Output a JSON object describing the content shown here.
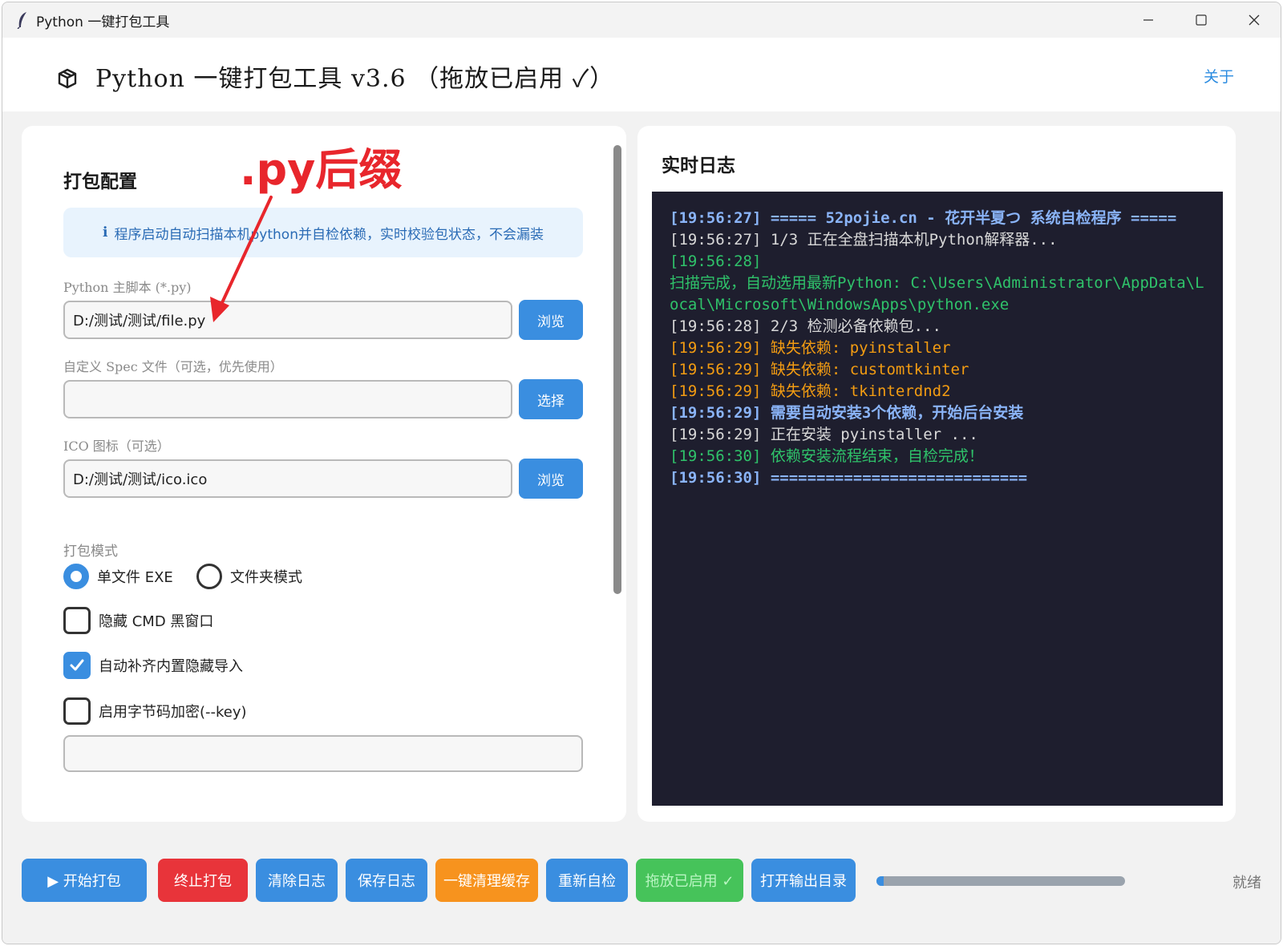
{
  "window": {
    "title": "Python 一键打包工具"
  },
  "header": {
    "title": "Python 一键打包工具 v3.6 （拖放已启用 ✓）",
    "about": "关于"
  },
  "config": {
    "section_title": "打包配置",
    "annotation": ".py后缀",
    "info": "程序启动自动扫描本机python并自检依赖，实时校验包状态，不会漏装",
    "info_icon": "ℹ",
    "script_label": "Python 主脚本 (*.py)",
    "script_value": "D:/测试/测试/file.py",
    "browse1": "浏览",
    "spec_label": "自定义 Spec 文件（可选，优先使用）",
    "spec_value": "",
    "choose": "选择",
    "ico_label": "ICO 图标（可选）",
    "ico_value": "D:/测试/测试/ico.ico",
    "browse2": "浏览",
    "mode_label": "打包模式",
    "mode_onefile": "单文件 EXE",
    "mode_folder": "文件夹模式",
    "hide_cmd": "隐藏 CMD 黑窗口",
    "auto_imports": "自动补齐内置隐藏导入",
    "encrypt": "启用字节码加密(--key)",
    "key_value": ""
  },
  "log": {
    "title": "实时日志",
    "lines": [
      {
        "text": "[19:56:27] ===== 52pojie.cn - 花开半夏つ 系统自检程序 =====",
        "kind": "blue"
      },
      {
        "text": "[19:56:27] 1/3 正在全盘扫描本机Python解释器...",
        "kind": "white"
      },
      {
        "text": "[19:56:28]",
        "kind": "green"
      },
      {
        "text": "扫描完成，自动选用最新Python: C:\\Users\\Administrator\\AppData\\Local\\Microsoft\\WindowsApps\\python.exe",
        "kind": "green"
      },
      {
        "text": "[19:56:28] 2/3 检测必备依赖包...",
        "kind": "white"
      },
      {
        "text": "[19:56:29] 缺失依赖: pyinstaller",
        "kind": "orange"
      },
      {
        "text": "[19:56:29] 缺失依赖: customtkinter",
        "kind": "orange"
      },
      {
        "text": "[19:56:29] 缺失依赖: tkinterdnd2",
        "kind": "orange"
      },
      {
        "text": "[19:56:29] 需要自动安装3个依赖，开始后台安装",
        "kind": "blue"
      },
      {
        "text": "[19:56:29] 正在安装 pyinstaller ...",
        "kind": "white"
      },
      {
        "text": "[19:56:30] 依赖安装流程结束，自检完成！",
        "kind": "green"
      },
      {
        "text": "[19:56:30] ============================",
        "kind": "blue"
      }
    ]
  },
  "toolbar": {
    "start": "▶ 开始打包",
    "stop": "终止打包",
    "clear_log": "清除日志",
    "save_log": "保存日志",
    "clean_cache": "一键清理缓存",
    "recheck": "重新自检",
    "drag_enabled": "拖放已启用 ✓",
    "open_output": "打开输出目录",
    "progress_fraction": 0.03,
    "status": "就绪"
  },
  "colors": {
    "accent": "#3a8ee0",
    "stop": "#e8343a",
    "clean": "#f7931e",
    "drag": "#46c35a",
    "annotation": "#e8262c",
    "log_bg": "#1e1e2e"
  }
}
